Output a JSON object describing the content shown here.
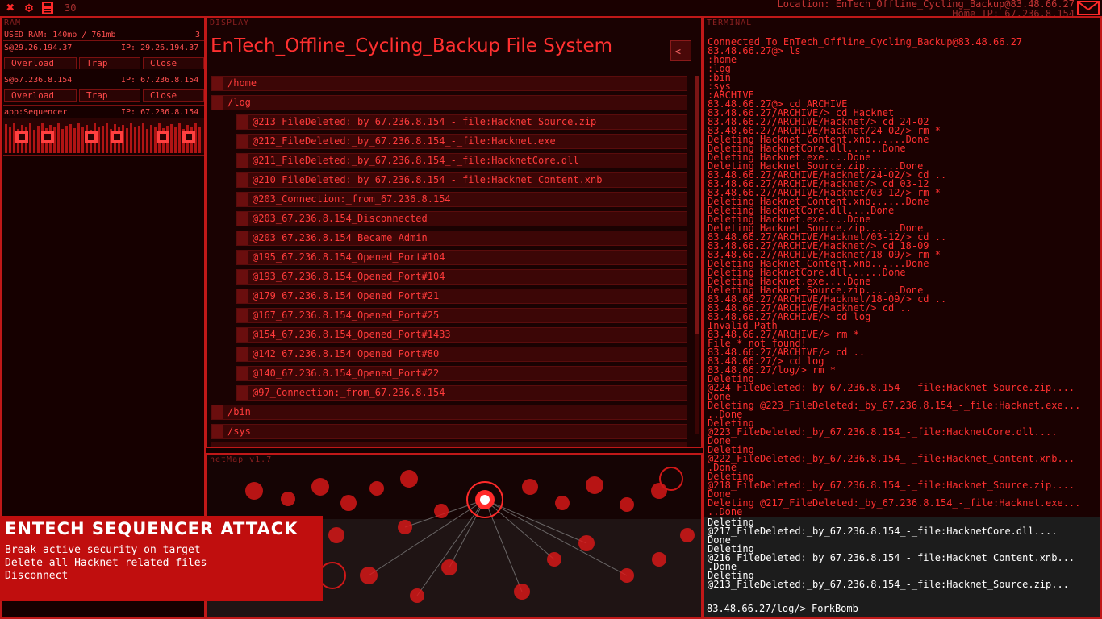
{
  "topbar": {
    "clock": "30",
    "location": "Location: EnTech_Offline_Cycling_Backup@83.48.66.27",
    "home_ip": "Home IP: 67.236.8.154"
  },
  "ram": {
    "label": "RAM",
    "used": "USED RAM: 140mb / 761mb",
    "count": "3",
    "processes": [
      {
        "name": "S@29.26.194.37",
        "ip": "IP: 29.26.194.37",
        "buttons": [
          "Overload",
          "Trap",
          "Close"
        ]
      },
      {
        "name": "S@67.236.8.154",
        "ip": "IP: 67.236.8.154",
        "buttons": [
          "Overload",
          "Trap",
          "Close"
        ]
      }
    ],
    "app": {
      "name": "app:Sequencer",
      "ip": "IP: 67.236.8.154"
    }
  },
  "display": {
    "label": "DISPLAY",
    "title": "EnTech_Offline_Cycling_Backup File System",
    "back": "<-",
    "folders": [
      "/home",
      "/log",
      "/bin",
      "/sys"
    ],
    "log_files": [
      "@213_FileDeleted:_by_67.236.8.154_-_file:Hacknet_Source.zip",
      "@212_FileDeleted:_by_67.236.8.154_-_file:Hacknet.exe",
      "@211_FileDeleted:_by_67.236.8.154_-_file:HacknetCore.dll",
      "@210_FileDeleted:_by_67.236.8.154_-_file:Hacknet_Content.xnb",
      "@203_Connection:_from_67.236.8.154",
      "@203_67.236.8.154_Disconnected",
      "@203_67.236.8.154_Became_Admin",
      "@195_67.236.8.154_Opened_Port#104",
      "@193_67.236.8.154_Opened_Port#104",
      "@179_67.236.8.154_Opened_Port#21",
      "@167_67.236.8.154_Opened_Port#25",
      "@154_67.236.8.154_Opened_Port#1433",
      "@142_67.236.8.154_Opened_Port#80",
      "@140_67.236.8.154_Opened_Port#22",
      "@97_Connection:_from_67.236.8.154"
    ]
  },
  "netmap": {
    "label": "netMap v1.7"
  },
  "terminal": {
    "label": "TERMINAL",
    "lines": [
      "Connected To EnTech_Offline_Cycling_Backup@83.48.66.27",
      "83.48.66.27@> ls",
      ":home",
      ":log",
      ":bin",
      ":sys",
      ":ARCHIVE",
      "83.48.66.27@> cd ARCHIVE",
      "83.48.66.27/ARCHIVE/> cd Hacknet",
      "83.48.66.27/ARCHIVE/Hacknet/> cd 24-02",
      "83.48.66.27/ARCHIVE/Hacknet/24-02/> rm *",
      "Deleting Hacknet_Content.xnb......Done",
      "Deleting HacknetCore.dll......Done",
      "Deleting Hacknet.exe....Done",
      "Deleting Hacknet_Source.zip......Done",
      "83.48.66.27/ARCHIVE/Hacknet/24-02/> cd ..",
      "83.48.66.27/ARCHIVE/Hacknet/> cd 03-12",
      "83.48.66.27/ARCHIVE/Hacknet/03-12/> rm *",
      "Deleting Hacknet_Content.xnb......Done",
      "Deleting HacknetCore.dll....Done",
      "Deleting Hacknet.exe....Done",
      "Deleting Hacknet_Source.zip......Done",
      "83.48.66.27/ARCHIVE/Hacknet/03-12/> cd ..",
      "83.48.66.27/ARCHIVE/Hacknet/> cd 18-09",
      "83.48.66.27/ARCHIVE/Hacknet/18-09/> rm *",
      "Deleting Hacknet_Content.xnb......Done",
      "Deleting HacknetCore.dll......Done",
      "Deleting Hacknet.exe....Done",
      "Deleting Hacknet_Source.zip......Done",
      "83.48.66.27/ARCHIVE/Hacknet/18-09/> cd ..",
      "83.48.66.27/ARCHIVE/Hacknet/> cd ..",
      "83.48.66.27/ARCHIVE/> cd log",
      "Invalid Path",
      "83.48.66.27/ARCHIVE/> rm *",
      "File * not found!",
      "83.48.66.27/ARCHIVE/> cd ..",
      "83.48.66.27/> cd log",
      "83.48.66.27/log/> rm *",
      "Deleting",
      "@224_FileDeleted:_by_67.236.8.154_-_file:Hacknet_Source.zip....",
      "Done",
      "Deleting @223_FileDeleted:_by_67.236.8.154_-_file:Hacknet.exe...",
      "..Done",
      "Deleting",
      "@223_FileDeleted:_by_67.236.8.154_-_file:HacknetCore.dll....",
      "Done",
      "Deleting",
      "@222_FileDeleted:_by_67.236.8.154_-_file:Hacknet_Content.xnb...",
      ".Done",
      "Deleting",
      "@218_FileDeleted:_by_67.236.8.154_-_file:Hacknet_Source.zip....",
      "Done",
      "Deleting @217_FileDeleted:_by_67.236.8.154_-_file:Hacknet.exe...",
      "..Done"
    ],
    "recent_lines": [
      "Deleting",
      "@217_FileDeleted:_by_67.236.8.154_-_file:HacknetCore.dll....",
      "Done",
      "Deleting",
      "@216_FileDeleted:_by_67.236.8.154_-_file:Hacknet_Content.xnb...",
      ".Done",
      "Deleting",
      "@213_FileDeleted:_by_67.236.8.154_-_file:Hacknet_Source.zip..."
    ],
    "prompt": "83.48.66.27/log/> ForkBomb"
  },
  "mission": {
    "title": "ENTECH SEQUENCER ATTACK",
    "lines": [
      "Break active security on target",
      "Delete all Hacknet related files",
      "Disconnect"
    ]
  },
  "colors": {
    "accent": "#ff2a2a",
    "border": "#c01818",
    "background": "#120000",
    "mission": "#c00e0e"
  }
}
